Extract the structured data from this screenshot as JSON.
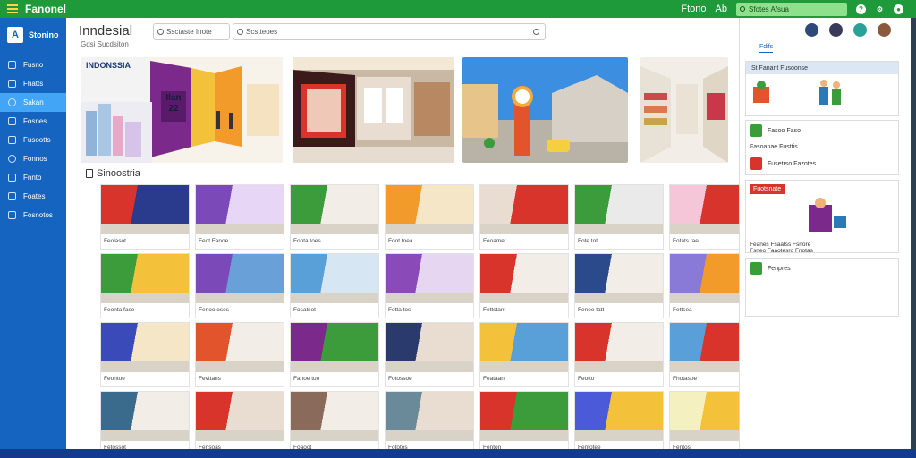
{
  "app": {
    "title": "Fanonel"
  },
  "topbar": {
    "link1": "Ftono",
    "link2": "Ab",
    "search_text": "Sfotes Afsua"
  },
  "sidebar": {
    "brand": "Stonino",
    "items": [
      {
        "label": "Fusno"
      },
      {
        "label": "Fhatts"
      },
      {
        "label": "Sakan"
      },
      {
        "label": "Fosnes"
      },
      {
        "label": "Fusootts"
      },
      {
        "label": "Fonnos"
      },
      {
        "label": "Fnnto"
      },
      {
        "label": "Foates"
      },
      {
        "label": "Fosnotos"
      }
    ]
  },
  "header": {
    "title": "Inndesial",
    "subtitle": "Gdsi  Sucdsiton",
    "search1_placeholder": "Ssctaste Inote",
    "search2_placeholder": "Scstteoes"
  },
  "hero": {
    "label": "INDONSSIA",
    "sign": "Ilan 22"
  },
  "section": {
    "title": "Sinoostria"
  },
  "cards": [
    "Feolasot",
    "Feot Fanoe",
    "Fonta toes",
    "Foot toea",
    "Feoamet",
    "Fote tot",
    "Fotats tae",
    "Feonta fase",
    "Fenoo oses",
    "Fosatsot",
    "Fotta tos",
    "Fettstant",
    "Fenee tatt",
    "Fettsea",
    "Feontoe",
    "Fevttans",
    "Fanoe tuo",
    "Fotossoe",
    "Feataan",
    "Feotto",
    "Fhotasoe",
    "Fetossot",
    "Fensoas",
    "Foaoot",
    "Fototos",
    "Fenton",
    "Fentotee",
    "Fentos"
  ],
  "rightpanel": {
    "tab": "Fdifs",
    "box1_header": "St  Fanant Fusoonse",
    "row1": "Fasoo Faso",
    "row2": "Fasoanae Fusttis",
    "row3": "Fusetrso Fazotes",
    "box2_header": "Fuotsnate",
    "box2_caption1": "Feanes Fsaatss Fsnore",
    "box2_caption2": "Fsneo Faaotesro Fnotas",
    "row4": "Fenpres"
  },
  "colors": {
    "topbar": "#1f9a3a",
    "sidebar": "#1565c0",
    "accent": "#42a5f5"
  }
}
